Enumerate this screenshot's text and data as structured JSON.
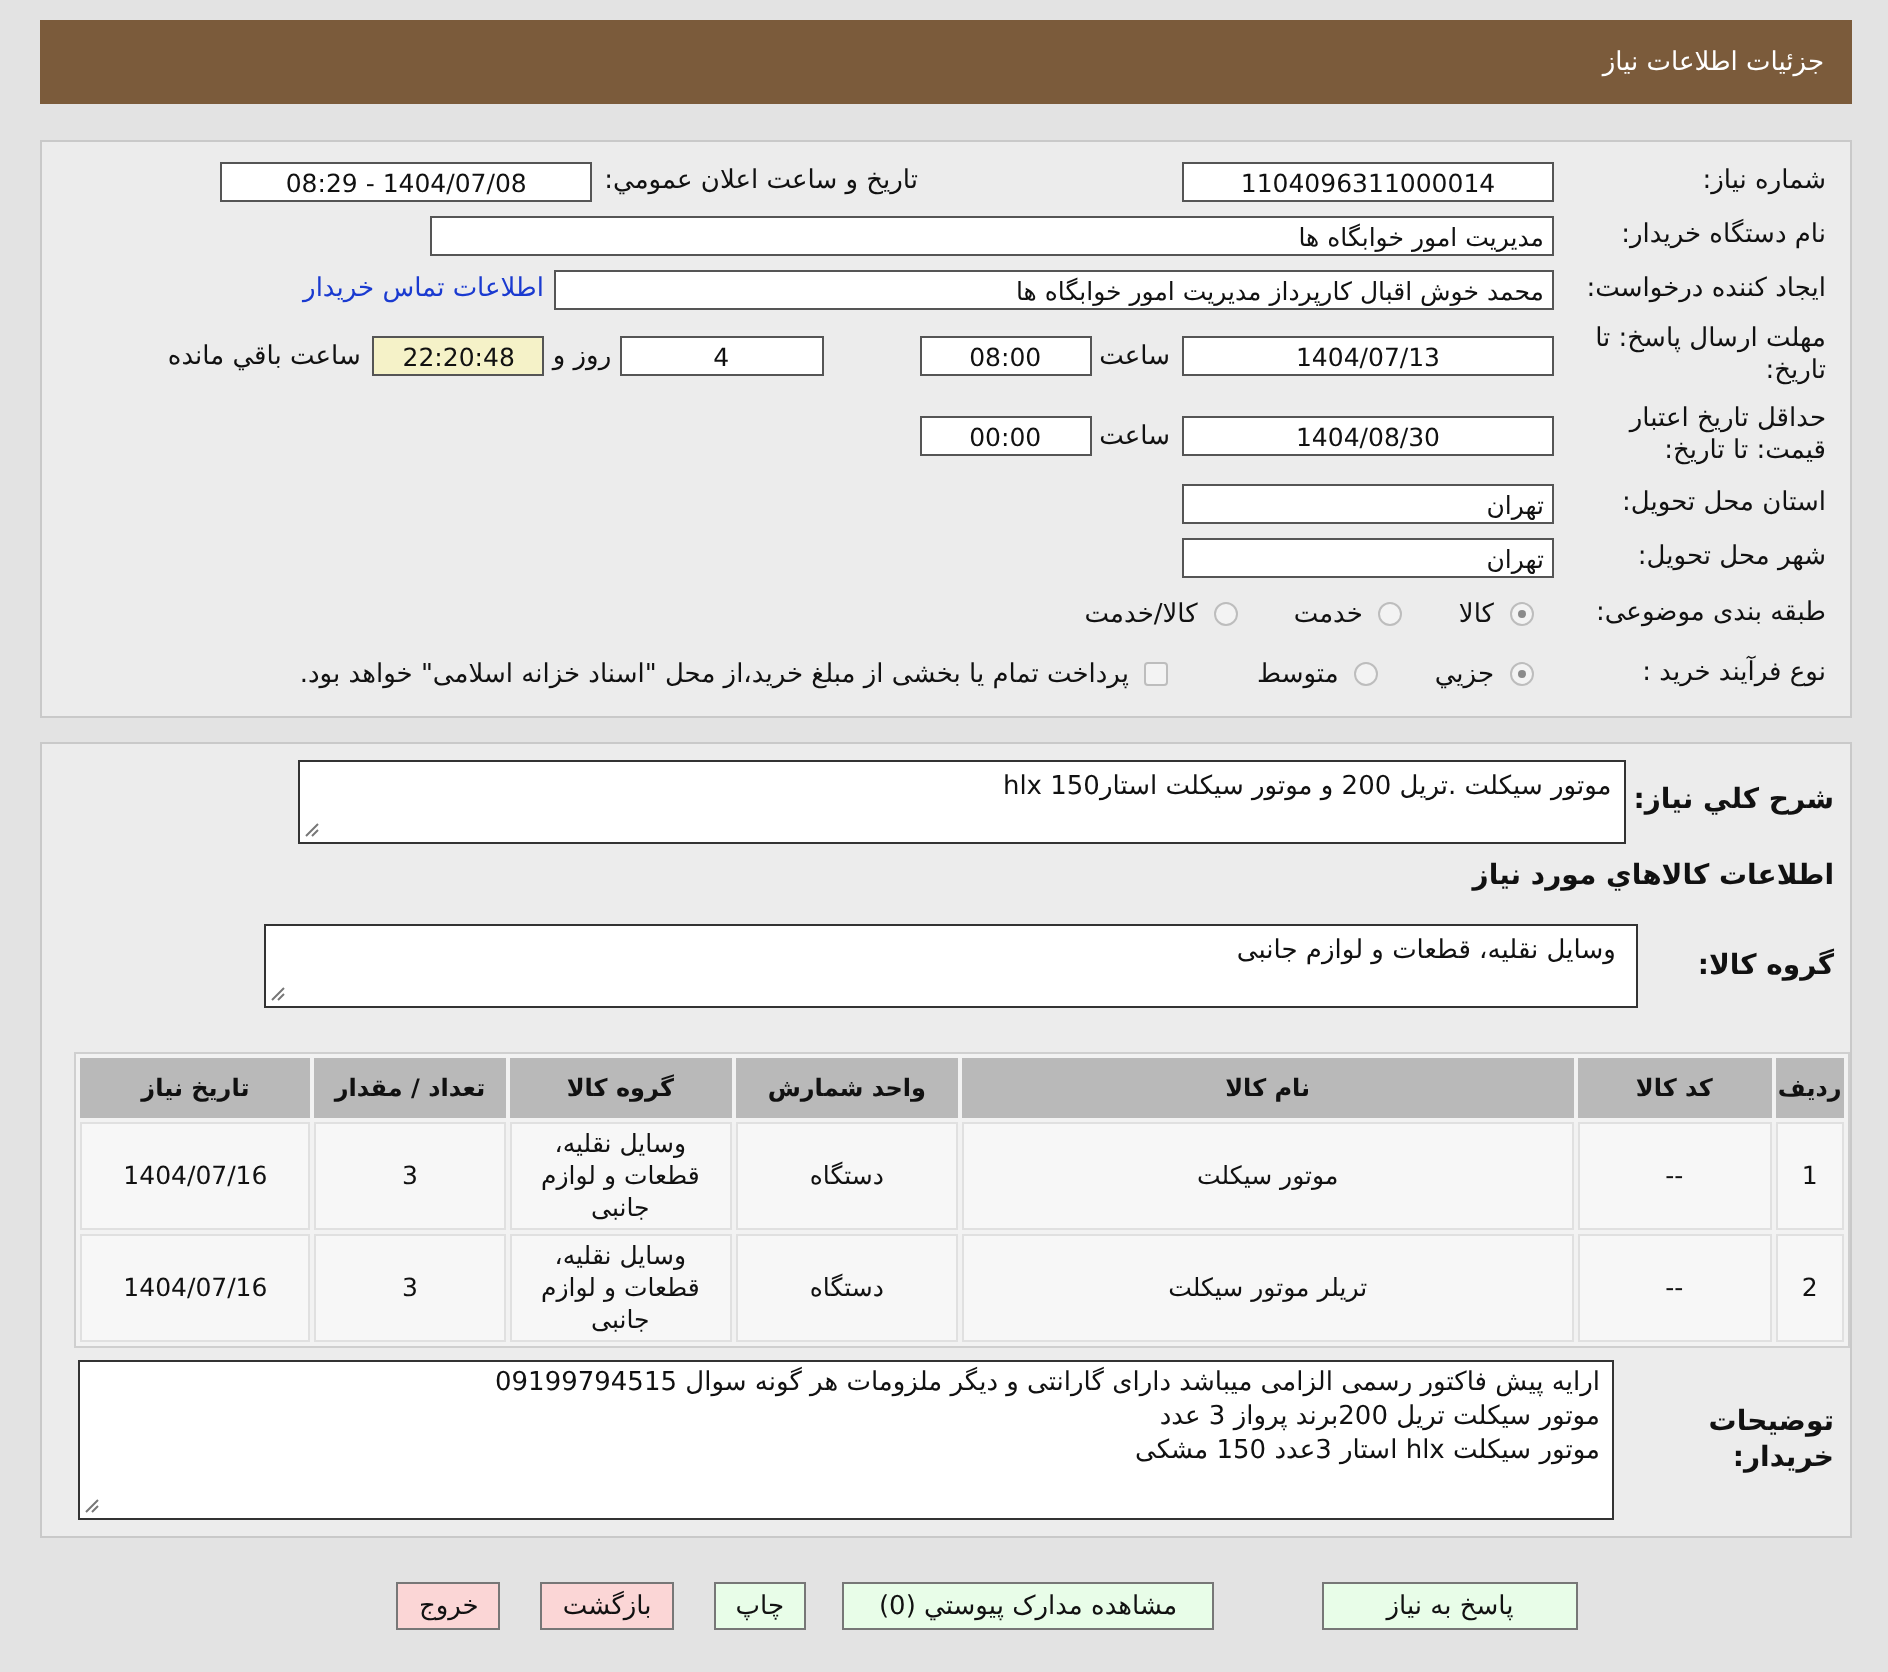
{
  "header": {
    "title": "جزئیات اطلاعات نیاز"
  },
  "details": {
    "need_number": {
      "label": "شماره نیاز:",
      "value": "1104096311000014"
    },
    "announce": {
      "label": "تاريخ و ساعت اعلان عمومي:",
      "value": "1404/07/08 - 08:29"
    },
    "buyer_org": {
      "label": "نام دستگاه خريدار:",
      "value": "مدیریت امور خوابگاه ها"
    },
    "creator": {
      "label": "ایجاد کننده درخواست:",
      "value": "محمد خوش اقبال کارپرداز مدیریت امور خوابگاه ها",
      "contact_link": "اطلاعات تماس خريدار"
    },
    "response_deadline": {
      "label": "مهلت ارسال پاسخ: تا تاریخ:",
      "date": "1404/07/13",
      "time_label": "ساعت",
      "time": "08:00",
      "days": "4",
      "days_label": "روز و",
      "remaining": "22:20:48",
      "remaining_label": "ساعت باقي مانده"
    },
    "price_validity": {
      "label": "حداقل تاريخ اعتبار قيمت: تا تاريخ:",
      "date": "1404/08/30",
      "time_label": "ساعت",
      "time": "00:00"
    },
    "province": {
      "label": "استان محل تحویل:",
      "value": "تهران"
    },
    "city": {
      "label": "شهر محل تحویل:",
      "value": "تهران"
    },
    "category": {
      "label": "طبقه بندی موضوعی:",
      "options": [
        {
          "label": "کالا",
          "selected": true
        },
        {
          "label": "خدمت",
          "selected": false
        },
        {
          "label": "کالا/خدمت",
          "selected": false
        }
      ]
    },
    "process": {
      "label": "نوع فرآیند خرید :",
      "options": [
        {
          "label": "جزيي",
          "selected": true
        },
        {
          "label": "متوسط",
          "selected": false
        }
      ],
      "treasury": {
        "label": "پرداخت تمام یا بخشی از مبلغ خرید،از محل \"اسناد خزانه اسلامی\" خواهد بود.",
        "checked": false
      }
    }
  },
  "needs": {
    "summary": {
      "label": "شرح کلي نياز:",
      "value": "موتور سیکلت .تریل 200 و موتور سیکلت استار150 hlx"
    },
    "heading": "اطلاعات کالاهاي مورد نياز",
    "goods_group": {
      "label": "گروه کالا:",
      "value": "وسایل نقلیه، قطعات و لوازم جانبی"
    },
    "table": {
      "columns": [
        "ردیف",
        "کد کالا",
        "نام کالا",
        "واحد شمارش",
        "گروه کالا",
        "تعداد / مقدار",
        "تاریخ نیاز"
      ],
      "rows": [
        {
          "row": "1",
          "code": "--",
          "name": "موتور سیکلت",
          "unit": "دستگاه",
          "group": "وسایل نقلیه، قطعات و لوازم جانبی",
          "qty": "3",
          "date": "1404/07/16"
        },
        {
          "row": "2",
          "code": "--",
          "name": "تریلر موتور سیکلت",
          "unit": "دستگاه",
          "group": "وسایل نقلیه، قطعات و لوازم جانبی",
          "qty": "3",
          "date": "1404/07/16"
        }
      ]
    },
    "buyer_notes": {
      "label": "توضیحات خریدار:",
      "lines": [
        "ارایه پیش فاکتور رسمی الزامی میباشد دارای گارانتی و دیگر ملزومات هر گونه سوال 09199794515",
        "موتور سیکلت تریل 200برند پرواز 3 عدد",
        "موتور سیکلت hlx استار 3عدد 150 مشکی"
      ]
    }
  },
  "buttons": [
    {
      "label": "پاسخ به نیاز",
      "kind": "action"
    },
    {
      "label": "مشاهده مدارک پیوستي (0)",
      "kind": "action"
    },
    {
      "label": "چاپ",
      "kind": "action"
    },
    {
      "label": "بازگشت",
      "kind": "exit"
    },
    {
      "label": "خروج",
      "kind": "exit"
    }
  ]
}
